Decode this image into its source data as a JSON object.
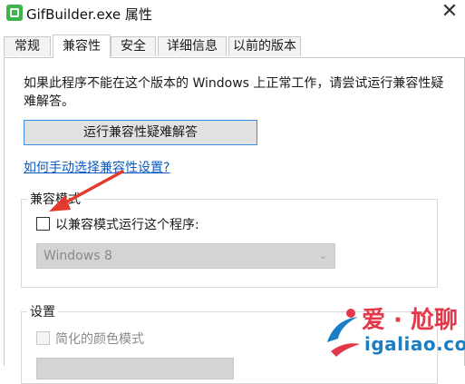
{
  "window": {
    "title": "GifBuilder.exe 属性",
    "close_glyph": "✕"
  },
  "tabs": [
    {
      "label": "常规",
      "active": false
    },
    {
      "label": "兼容性",
      "active": true
    },
    {
      "label": "安全",
      "active": false
    },
    {
      "label": "详细信息",
      "active": false
    },
    {
      "label": "以前的版本",
      "active": false
    }
  ],
  "compat": {
    "intro": "如果此程序不能在这个版本的 Windows 上正常工作，请尝试运行兼容性疑难解答。",
    "trouble_button": "运行兼容性疑难解答",
    "help_link": "如何手动选择兼容性设置?",
    "mode_group": {
      "label": "兼容模式",
      "checkbox_label": "以兼容模式运行这个程序:",
      "checked": false,
      "select_value": "Windows 8"
    },
    "settings_group": {
      "label": "设置",
      "color_checkbox_label": "简化的颜色模式",
      "checked": false
    }
  },
  "watermark": {
    "line1": "爱 · 尬聊",
    "line2": "igaliao.com",
    "colors": {
      "red": "#e2384a",
      "blue": "#1a7ec4"
    }
  },
  "annotation": {
    "arrow_color": "#e33a2d"
  }
}
